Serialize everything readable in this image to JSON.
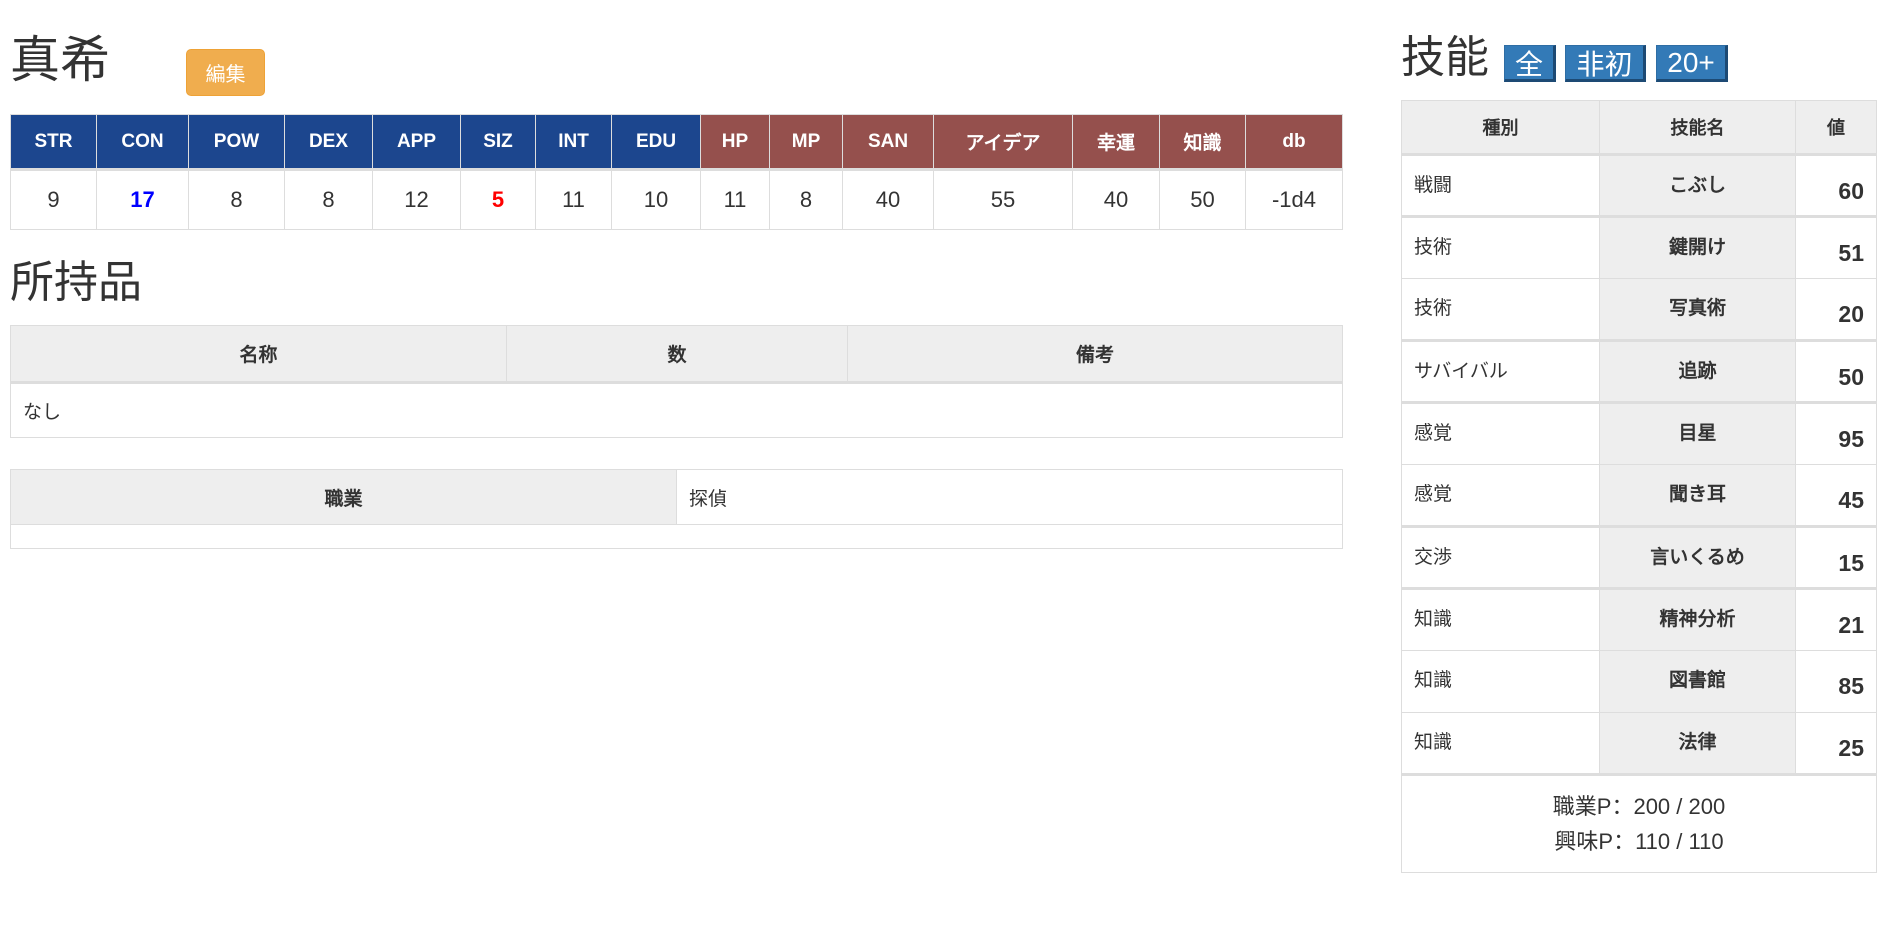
{
  "character": {
    "name": "真希",
    "edit_label": "編集"
  },
  "stats": {
    "headers": [
      "STR",
      "CON",
      "POW",
      "DEX",
      "APP",
      "SIZ",
      "INT",
      "EDU",
      "HP",
      "MP",
      "SAN",
      "アイデア",
      "幸運",
      "知識",
      "db"
    ],
    "values": [
      "9",
      "17",
      "8",
      "8",
      "12",
      "5",
      "11",
      "10",
      "11",
      "8",
      "40",
      "55",
      "40",
      "50",
      "-1d4"
    ],
    "colors": {
      "primary": "#1c468e",
      "derived": "#95504d",
      "high": "#0000ff",
      "low": "#ff0000"
    }
  },
  "items": {
    "title": "所持品",
    "headers": [
      "名称",
      "数",
      "備考"
    ],
    "empty": "なし"
  },
  "job": {
    "label": "職業",
    "value": "探偵"
  },
  "skills": {
    "title": "技能",
    "filters": [
      "全",
      "非初",
      "20+"
    ],
    "headers": [
      "種別",
      "技能名",
      "値"
    ],
    "rows": [
      {
        "category": "戦闘",
        "name": "こぶし",
        "value": "60"
      },
      {
        "category": "技術",
        "name": "鍵開け",
        "value": "51"
      },
      {
        "category": "技術",
        "name": "写真術",
        "value": "20"
      },
      {
        "category": "サバイバル",
        "name": "追跡",
        "value": "50"
      },
      {
        "category": "感覚",
        "name": "目星",
        "value": "95"
      },
      {
        "category": "感覚",
        "name": "聞き耳",
        "value": "45"
      },
      {
        "category": "交渉",
        "name": "言いくるめ",
        "value": "15"
      },
      {
        "category": "知識",
        "name": "精神分析",
        "value": "21"
      },
      {
        "category": "知識",
        "name": "図書館",
        "value": "85"
      },
      {
        "category": "知識",
        "name": "法律",
        "value": "25"
      }
    ],
    "occupation_points": "職業P：200 / 200",
    "interest_points": "興味P：110 / 110"
  }
}
